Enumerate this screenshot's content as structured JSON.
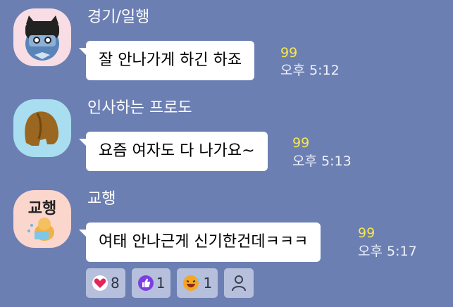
{
  "messages": [
    {
      "sender": "경기/일행",
      "text": "잘 안나가게 하긴 하죠",
      "unread": "99",
      "time": "오후 5:12"
    },
    {
      "sender": "인사하는 프로도",
      "text": "요즘 여자도 다 나가요~",
      "unread": "99",
      "time": "오후 5:13"
    },
    {
      "sender": "교행",
      "avatar_text": "교행",
      "text": "여태 안나근게 신기한건데ㅋㅋㅋ",
      "unread": "99",
      "time": "오후 5:17"
    }
  ],
  "reactions": [
    {
      "icon": "heart-icon",
      "count": "8",
      "color": "#e5245a"
    },
    {
      "icon": "thumbs-up-icon",
      "count": "1",
      "color": "#7a3fe0"
    },
    {
      "icon": "laugh-emoji-icon",
      "count": "1",
      "color": "#f5a623"
    },
    {
      "icon": "person-icon",
      "count": ""
    }
  ]
}
